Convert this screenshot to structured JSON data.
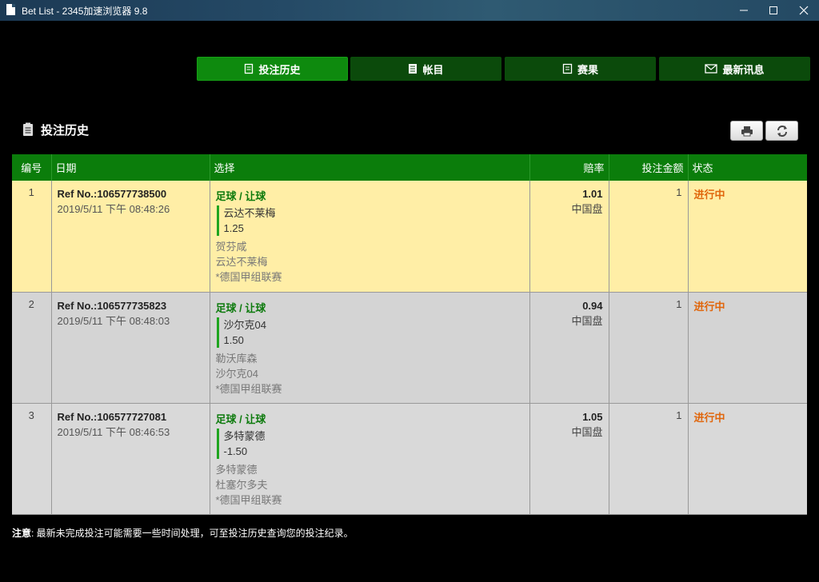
{
  "window": {
    "title": "Bet List - 2345加速浏览器 9.8"
  },
  "tabs": [
    {
      "label": "投注历史",
      "icon": "receipt-icon",
      "active": true
    },
    {
      "label": "帐目",
      "icon": "ledger-icon",
      "active": false
    },
    {
      "label": "赛果",
      "icon": "results-icon",
      "active": false
    },
    {
      "label": "最新讯息",
      "icon": "envelope-icon",
      "active": false
    }
  ],
  "section": {
    "title": "投注历史",
    "icon": "receipt-icon"
  },
  "toolbar": {
    "print_icon": "printer-icon",
    "refresh_icon": "refresh-icon"
  },
  "table": {
    "headers": [
      "编号",
      "日期",
      "选择",
      "赔率",
      "投注金额",
      "状态"
    ],
    "rows": [
      {
        "no": "1",
        "ref": "Ref No.:106577738500",
        "date": "2019/5/11 下午 08:48:26",
        "sport": "足球 / 让球",
        "pick": "云达不莱梅",
        "line": "1.25",
        "home": "贺芬咸",
        "away": "云达不莱梅",
        "league": "*德国甲组联赛",
        "odds": "1.01",
        "odds_type": "中国盘",
        "amount": "1",
        "status": "进行中"
      },
      {
        "no": "2",
        "ref": "Ref No.:106577735823",
        "date": "2019/5/11 下午 08:48:03",
        "sport": "足球 / 让球",
        "pick": "沙尔克04",
        "line": "1.50",
        "home": "勒沃库森",
        "away": "沙尔克04",
        "league": "*德国甲组联赛",
        "odds": "0.94",
        "odds_type": "中国盘",
        "amount": "1",
        "status": "进行中"
      },
      {
        "no": "3",
        "ref": "Ref No.:106577727081",
        "date": "2019/5/11 下午 08:46:53",
        "sport": "足球 / 让球",
        "pick": "多特蒙德",
        "line": "-1.50",
        "home": "多特蒙德",
        "away": "杜塞尔多夫",
        "league": "*德国甲组联赛",
        "odds": "1.05",
        "odds_type": "中国盘",
        "amount": "1",
        "status": "进行中"
      }
    ]
  },
  "note": {
    "label": "注意",
    "text": ": 最新未完成投注可能需要一些时间处理，可至投注历史查询您的投注纪录。"
  },
  "colors": {
    "header_green": "#0b7d0b",
    "active_tab": "#0e8a0e",
    "row_highlight": "#ffeea6",
    "row_grey": "#d4d4d4",
    "status_orange": "#e0660c"
  }
}
